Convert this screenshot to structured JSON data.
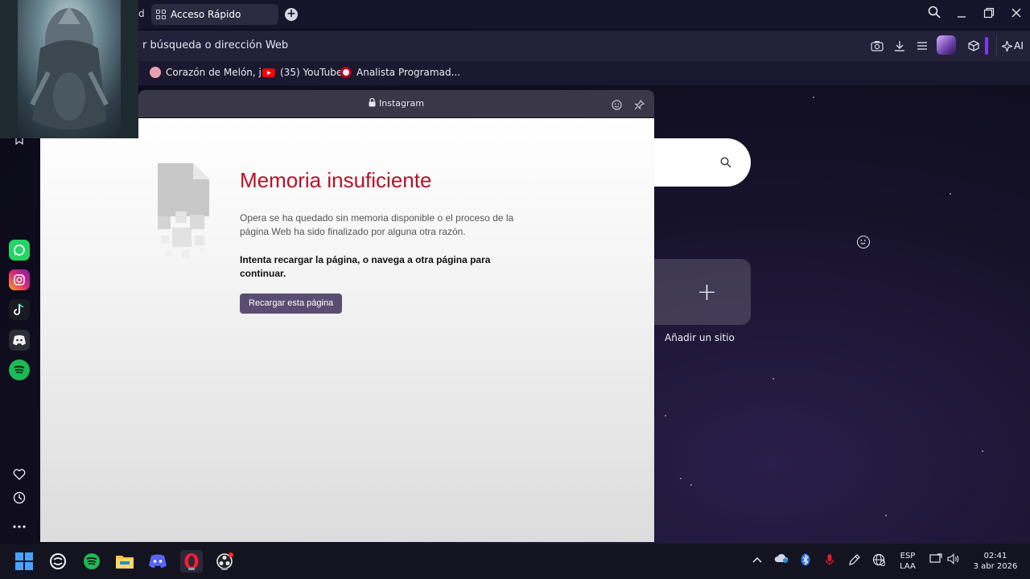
{
  "tabs": {
    "fragment_label": "d",
    "active_label": "Acceso Rápido",
    "new_tab_glyph": "+"
  },
  "address_bar": {
    "text": "r búsqueda o dirección Web",
    "ai_label": "AI"
  },
  "bookmarks": [
    {
      "label": "Corazón de Melón, j...",
      "icon": "cake-icon",
      "color": "#e8a0b0"
    },
    {
      "label": "(35) YouTube",
      "icon": "youtube-icon",
      "color": "#ff0000"
    },
    {
      "label": "Analista Programad...",
      "icon": "analista-icon",
      "color": "#f2f2f2"
    }
  ],
  "panel": {
    "title": "Instagram",
    "error_title": "Memoria insuficiente",
    "error_description": "Opera se ha quedado sin memoria disponible o el proceso de la página Web ha sido finalizado por alguna otra razón.",
    "error_instruction": "Intenta recargar la página, o navega a otra página para continuar.",
    "reload_button": "Recargar esta página"
  },
  "speed_dial": {
    "add_site_label": "Añadir un sitio",
    "add_glyph": "+"
  },
  "sidebar_apps": [
    {
      "name": "whatsapp",
      "color": "#25d366"
    },
    {
      "name": "instagram",
      "color": "#d62976"
    },
    {
      "name": "tiktok",
      "color": "#222"
    },
    {
      "name": "discord",
      "color": "#3a3a48"
    },
    {
      "name": "spotify",
      "color": "#1db954"
    }
  ],
  "taskbar": {
    "language_top": "ESP",
    "language_bottom": "LAA",
    "time": "02:41",
    "date": "3 abr 2026"
  },
  "colors": {
    "accent": "#7c3aed",
    "error_red": "#b8112a",
    "reload_button": "#5b4d72"
  }
}
